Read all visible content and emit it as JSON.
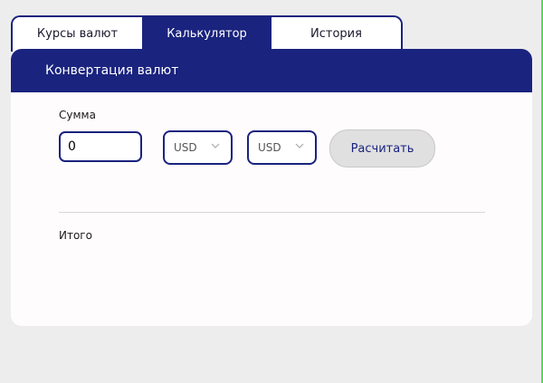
{
  "tabs": [
    {
      "label": "Курсы валют",
      "active": false
    },
    {
      "label": "Калькулятор",
      "active": true
    },
    {
      "label": "История",
      "active": false
    }
  ],
  "card": {
    "title": "Конвертация валют"
  },
  "form": {
    "amount_label": "Сумма",
    "amount_value": "0",
    "from_currency": "USD",
    "to_currency": "USD",
    "calculate_label": "Расчитать"
  },
  "result": {
    "total_label": "Итого"
  },
  "icons": {
    "select_arrow": "chevron-down-icon"
  },
  "colors": {
    "accent": "#1a237e",
    "background": "#ededed",
    "button_bg": "#e0e0e0"
  }
}
